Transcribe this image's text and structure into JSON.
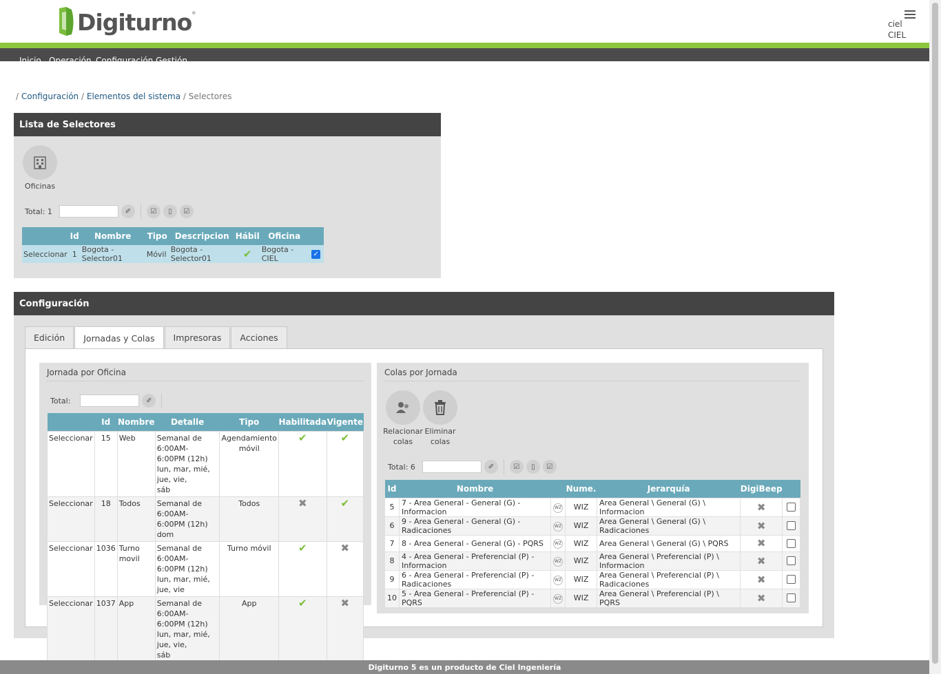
{
  "header": {
    "brand": "Digiturno",
    "brand_mark": "®",
    "user_line1": "ciel",
    "user_line2": "CIEL"
  },
  "nav": [
    "Inicio",
    "Operación",
    "Configuración",
    "Gestión"
  ],
  "breadcrumb": {
    "sep": "/",
    "item1": "Configuración",
    "item2": "Elementos del sistema",
    "item3": "Selectores"
  },
  "selectores_panel": {
    "title": "Lista de Selectores",
    "offices_label": "Oficinas",
    "total_label": "Total:",
    "total_value": "1",
    "columns": [
      "",
      "Id",
      "Nombre",
      "Tipo",
      "Descripcion",
      "Hábil",
      "Oficina",
      ""
    ],
    "row": {
      "select": "Seleccionar",
      "id": "1",
      "nombre": "Bogota - Selector01",
      "tipo": "Móvil",
      "descripcion": "Bogota - Selector01",
      "habil": true,
      "oficina": "Bogota - CIEL",
      "checked": true
    }
  },
  "config_panel": {
    "title": "Configuración",
    "tabs": [
      "Edición",
      "Jornadas y Colas",
      "Impresoras",
      "Acciones"
    ],
    "active_tab": 1
  },
  "jornada": {
    "title": "Jornada por Oficina",
    "total_label": "Total:",
    "columns": [
      "",
      "Id",
      "Nombre",
      "Detalle",
      "Tipo",
      "Habilitada",
      "Vigente"
    ],
    "rows": [
      {
        "select": "Seleccionar",
        "id": "15",
        "nombre": "Web",
        "detalle": [
          "Semanal de 6:00AM-",
          "6:00PM (12h)",
          "lun, mar, mié, jue, vie,",
          "sáb"
        ],
        "tipo": "Agendamiento móvil",
        "tipo_red": true,
        "habilitada": true,
        "vigente": true
      },
      {
        "select": "Seleccionar",
        "id": "18",
        "nombre": "Todos",
        "detalle": [
          "Semanal de 6:00AM-",
          "6:00PM (12h)",
          "dom"
        ],
        "tipo": "Todos",
        "tipo_red": false,
        "habilitada": false,
        "vigente": true
      },
      {
        "select": "Seleccionar",
        "id": "1036",
        "nombre": "Turno movil",
        "detalle": [
          "Semanal de 6:00AM-",
          "6:00PM (12h)",
          "lun, mar, mié, jue, vie"
        ],
        "tipo": "Turno móvil",
        "tipo_red": true,
        "habilitada": true,
        "vigente": false
      },
      {
        "select": "Seleccionar",
        "id": "1037",
        "nombre": "App",
        "detalle": [
          "Semanal de 6:00AM-",
          "6:00PM (12h)",
          "lun, mar, mié, jue, vie,",
          "sáb"
        ],
        "tipo": "App",
        "tipo_red": true,
        "habilitada": true,
        "vigente": false
      }
    ]
  },
  "colas": {
    "title": "Colas por Jornada",
    "relate_label": "Relacionar colas",
    "delete_label": "Eliminar colas",
    "total_label": "Total:",
    "total_value": "6",
    "columns": [
      "Id",
      "Nombre",
      "",
      "Nume.",
      "Jerarquía",
      "DigiBeep",
      ""
    ],
    "rows": [
      {
        "id": "5",
        "nombre": "7 - Area General - General (G) - Informacion",
        "nume": "WIZ",
        "jerarquia": "Area General \\ General (G) \\ Informacion"
      },
      {
        "id": "6",
        "nombre": "9 - Area General - General (G) - Radicaciones",
        "nume": "WIZ",
        "jerarquia": "Area General \\ General (G) \\ Radicaciones"
      },
      {
        "id": "7",
        "nombre": "8 - Area General - General (G) - PQRS",
        "nume": "WIZ",
        "jerarquia": "Area General \\ General (G) \\ PQRS"
      },
      {
        "id": "8",
        "nombre": "4 - Area General - Preferencial (P) - Informacion",
        "nume": "WIZ",
        "jerarquia": "Area General \\ Preferencial (P) \\ Informacion"
      },
      {
        "id": "9",
        "nombre": "6 - Area General - Preferencial (P) - Radicaciones",
        "nume": "WIZ",
        "jerarquia": "Area General \\ Preferencial (P) \\ Radicaciones"
      },
      {
        "id": "10",
        "nombre": "5 - Area General - Preferencial (P) - PQRS",
        "nume": "WIZ",
        "jerarquia": "Area General \\ Preferencial (P) \\ PQRS"
      }
    ]
  },
  "footer": "Digiturno 5 es un producto de Ciel Ingeniería",
  "colors": {
    "accent_green": "#8dc63f",
    "header_dark": "#444444",
    "table_header": "#6aa9ba",
    "link": "#235a82",
    "tipo_red": "#e0401c"
  }
}
